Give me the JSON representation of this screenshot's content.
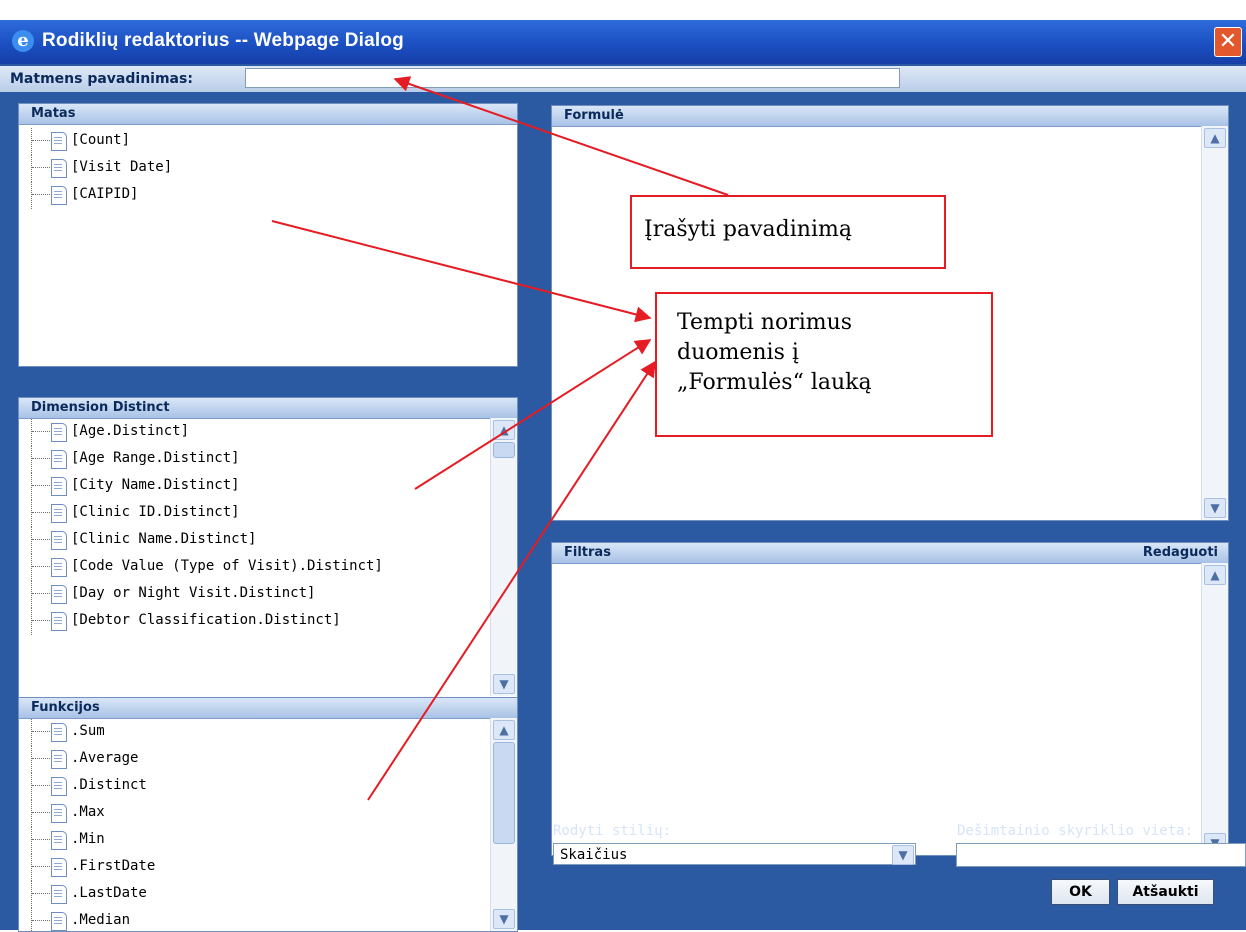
{
  "dialog": {
    "title": "Rodiklių redaktorius -- Webpage Dialog",
    "title_icon": "ie-icon",
    "close_glyph": "✕"
  },
  "name_bar": {
    "label": "Matmens pavadinimas:",
    "value": ""
  },
  "panels": {
    "matas": {
      "title": "Matas",
      "items": [
        "[Count]",
        "[Visit Date]",
        "[CAIPID]"
      ]
    },
    "dimension": {
      "title": "Dimension Distinct",
      "items": [
        "[Age.Distinct]",
        "[Age Range.Distinct]",
        "[City Name.Distinct]",
        "[Clinic ID.Distinct]",
        "[Clinic Name.Distinct]",
        "[Code Value (Type of Visit).Distinct]",
        "[Day or Night Visit.Distinct]",
        "[Debtor Classification.Distinct]"
      ]
    },
    "funkcijos": {
      "title": "Funkcijos",
      "items": [
        ".Sum",
        ".Average",
        ".Distinct",
        ".Max",
        ".Min",
        ".FirstDate",
        ".LastDate",
        ".Median"
      ]
    },
    "formule": {
      "title": "Formulė",
      "value": ""
    },
    "filtras": {
      "title": "Filtras",
      "edit_label": "Redaguoti",
      "value": ""
    }
  },
  "footer": {
    "style_label": "Rodyti stilių:",
    "style_value": "Skaičius",
    "decimal_label": "Dešimtainio skyriklio vieta:",
    "decimal_value": "",
    "ok_label": "OK",
    "cancel_label": "Atšaukti"
  },
  "annotations": {
    "callout1": "Įrašyti pavadinimą",
    "callout2_line1": "Tempti norimus",
    "callout2_line2": "duomenis į",
    "callout2_line3": "„Formulės“ lauką",
    "arrow_color": "#e51c23"
  },
  "colors": {
    "titlebar": "#1b4fc2",
    "body": "#2c5aa2",
    "panel_header": "#a8c2e6"
  }
}
